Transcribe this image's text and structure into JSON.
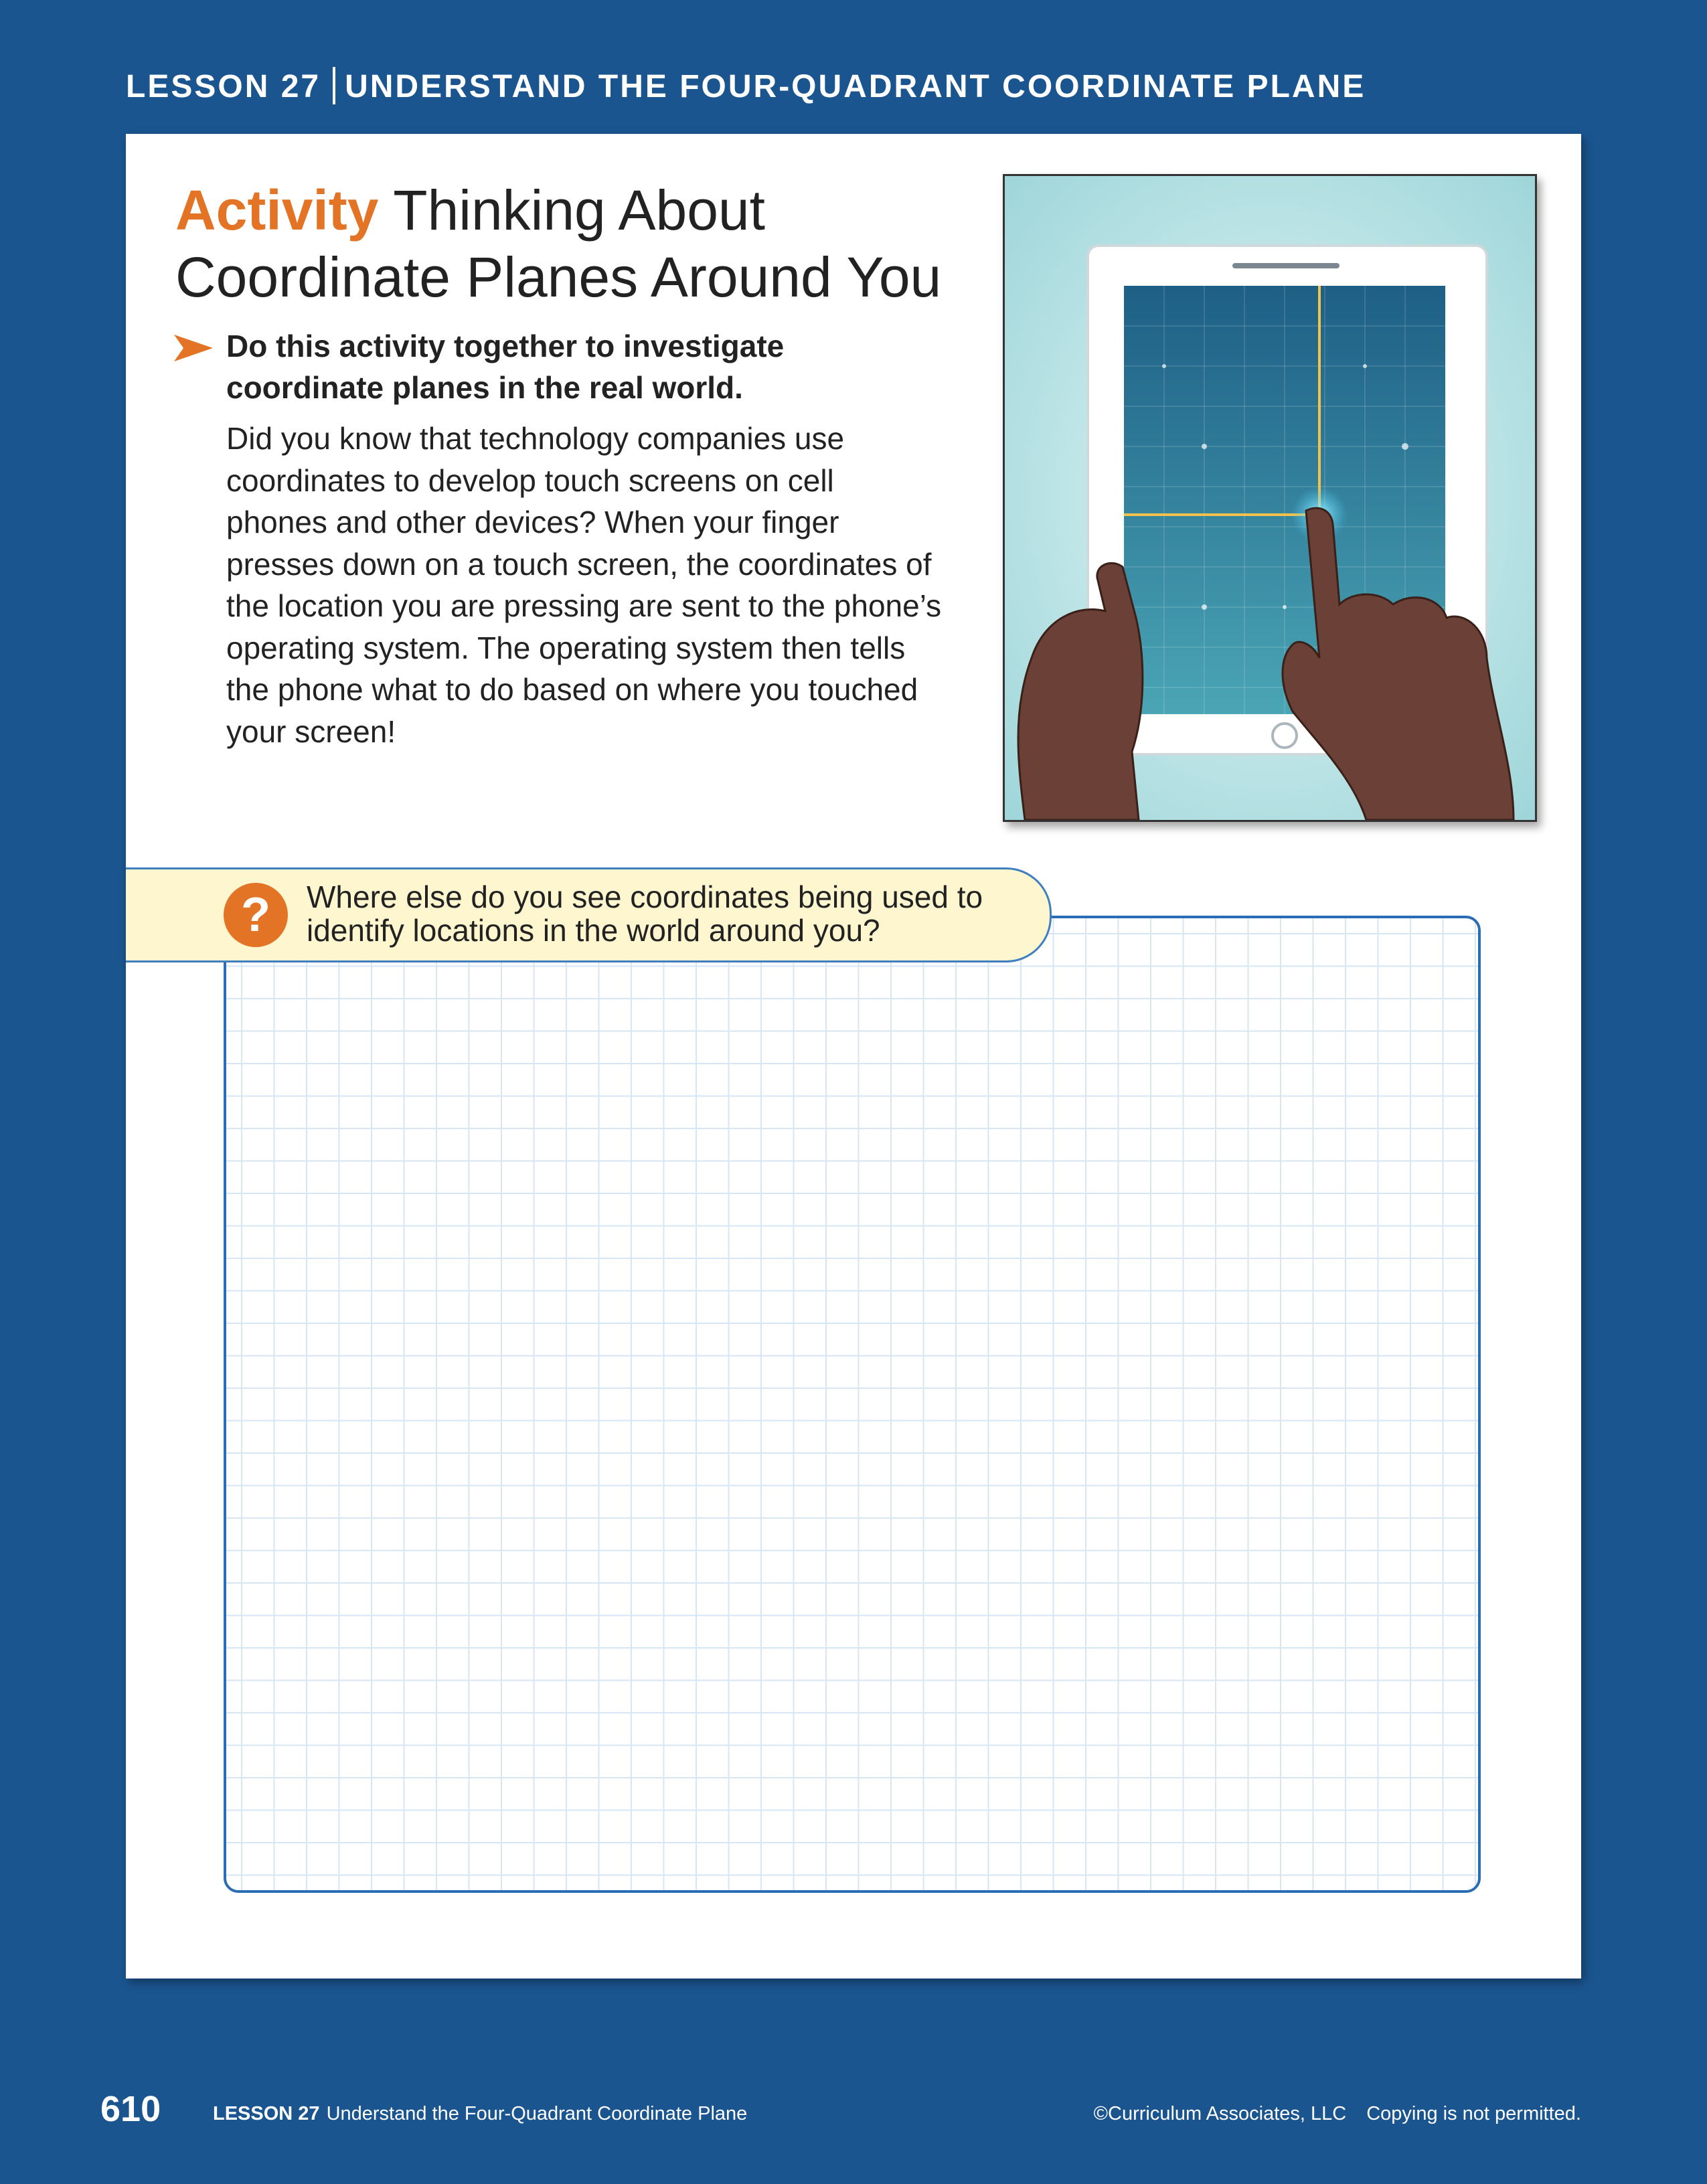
{
  "header": {
    "lesson": "LESSON 27",
    "title": "UNDERSTAND THE FOUR-QUADRANT COORDINATE PLANE"
  },
  "activity": {
    "accent": "Activity",
    "title_line1": "Thinking About",
    "title_line2": "Coordinate Planes Around You",
    "instruction_line1": "Do this activity together to investigate",
    "instruction_line2": "coordinate planes in the real world.",
    "body_lines": [
      "Did you know that technology companies use",
      "coordinates to develop touch screens on cell",
      "phones and other devices? When your finger",
      "presses down on a touch screen, the coordinates of",
      "the location you are pressing are sent to the phone’s",
      "operating system. The operating system then tells",
      "the phone what to do based on where you touched",
      "your screen!"
    ]
  },
  "question": {
    "icon": "?",
    "line1": "Where else do you see coordinates being used to",
    "line2": "identify locations in the world around you?"
  },
  "footer": {
    "page_number": "610",
    "lesson_label": "LESSON 27",
    "lesson_title": "Understand the Four-Quadrant Coordinate Plane",
    "copyright": "©Curriculum Associates, LLC",
    "notice": "Copying is not permitted."
  },
  "colors": {
    "page_background": "#1b5590",
    "accent_orange": "#e37426",
    "question_bar": "#fdf6cf",
    "grid_border": "#2a6db5"
  }
}
